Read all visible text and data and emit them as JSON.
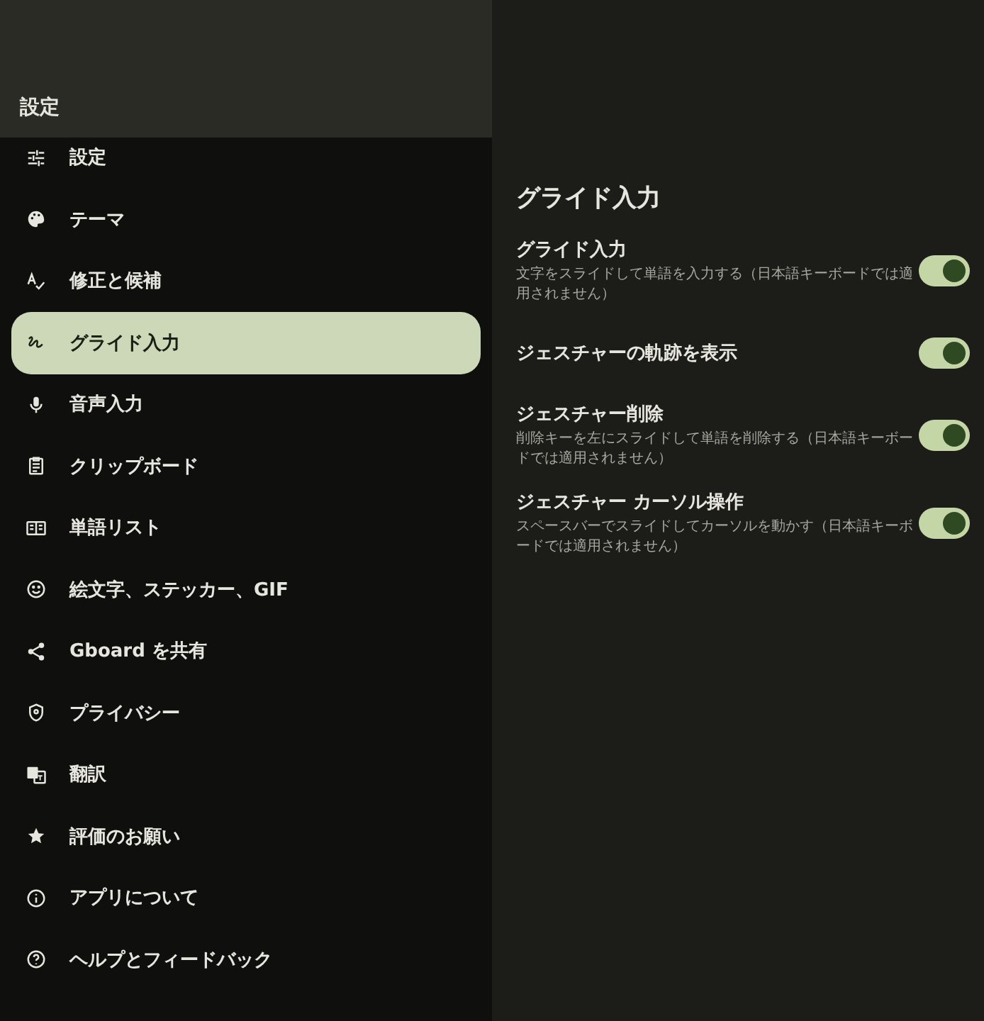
{
  "header": {
    "title": "設定"
  },
  "sidebar": {
    "items": [
      {
        "label": "設定",
        "selected": false
      },
      {
        "label": "テーマ",
        "selected": false
      },
      {
        "label": "修正と候補",
        "selected": false
      },
      {
        "label": "グライド入力",
        "selected": true
      },
      {
        "label": "音声入力",
        "selected": false
      },
      {
        "label": "クリップボード",
        "selected": false
      },
      {
        "label": "単語リスト",
        "selected": false
      },
      {
        "label": "絵文字、ステッカー、GIF",
        "selected": false
      },
      {
        "label": "Gboard を共有",
        "selected": false
      },
      {
        "label": "プライバシー",
        "selected": false
      },
      {
        "label": "翻訳",
        "selected": false
      },
      {
        "label": "評価のお願い",
        "selected": false
      },
      {
        "label": "アプリについて",
        "selected": false
      },
      {
        "label": "ヘルプとフィードバック",
        "selected": false
      }
    ]
  },
  "content": {
    "title": "グライド入力",
    "settings": [
      {
        "title": "グライド入力",
        "description": "文字をスライドして単語を入力する（日本語キーボードでは適用されません）",
        "on": true
      },
      {
        "title": "ジェスチャーの軌跡を表示",
        "on": true
      },
      {
        "title": "ジェスチャー削除",
        "description": "削除キーを左にスライドして単語を削除する（日本語キーボードでは適用されません）",
        "on": true
      },
      {
        "title": "ジェスチャー カーソル操作",
        "description": "スペースバーでスライドしてカーソルを動かす（日本語キーボードでは適用されません）",
        "on": true
      }
    ]
  }
}
